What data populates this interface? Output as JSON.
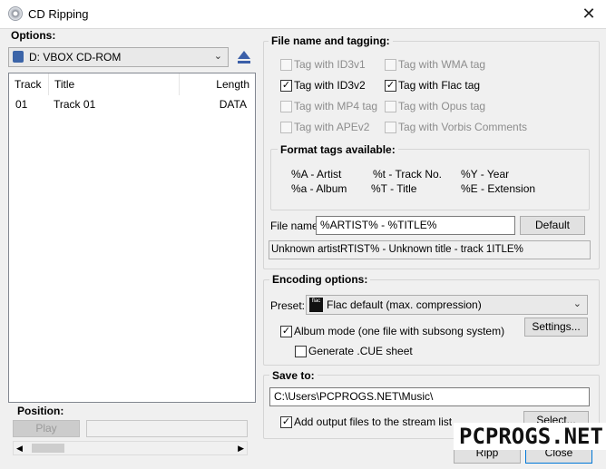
{
  "window": {
    "title": "CD Ripping",
    "close_glyph": "✕"
  },
  "options": {
    "label": "Options:",
    "drive": "D: VBOX CD-ROM",
    "eject_icon": "eject-icon",
    "columns": [
      "Track",
      "Title",
      "Length"
    ],
    "tracks": [
      {
        "track": "01",
        "title": "Track 01",
        "length": "DATA"
      }
    ]
  },
  "position": {
    "label": "Position:",
    "play": "Play"
  },
  "tagging": {
    "label": "File name and tagging:",
    "tags": [
      {
        "label": "Tag with ID3v1",
        "checked": false,
        "enabled": false
      },
      {
        "label": "Tag with WMA tag",
        "checked": false,
        "enabled": false
      },
      {
        "label": "Tag with ID3v2",
        "checked": true,
        "enabled": true
      },
      {
        "label": "Tag with Flac tag",
        "checked": true,
        "enabled": true
      },
      {
        "label": "Tag with MP4 tag",
        "checked": false,
        "enabled": false
      },
      {
        "label": "Tag with Opus tag",
        "checked": false,
        "enabled": false
      },
      {
        "label": "Tag with APEv2",
        "checked": false,
        "enabled": false
      },
      {
        "label": "Tag with Vorbis Comments",
        "checked": false,
        "enabled": false
      }
    ],
    "format_label": "Format tags available:",
    "format_tags": [
      "%A - Artist",
      "%t - Track No.",
      "%Y - Year",
      "%a - Album",
      "%T - Title",
      "%E - Extension"
    ],
    "filename_label": "File name:",
    "filename_value": "%ARTIST% - %TITLE%",
    "default_btn": "Default",
    "preview": "Unknown artistRTIST% - Unknown title - track 1ITLE%"
  },
  "encoding": {
    "label": "Encoding options:",
    "preset_label": "Preset:",
    "preset_icon_text": "flac",
    "preset_value": "Flac default (max. compression)",
    "album_mode": "Album mode (one file with subsong system)",
    "album_mode_checked": true,
    "cue": "Generate .CUE sheet",
    "cue_checked": false,
    "settings_btn": "Settings..."
  },
  "save": {
    "label": "Save to:",
    "path": "C:\\Users\\PCPROGS.NET\\Music\\",
    "add_output": "Add output files to the stream list",
    "add_output_checked": true,
    "select_btn": "Select..."
  },
  "footer": {
    "ripp": "Ripp",
    "close": "Close"
  },
  "watermark": "PCPROGS.NET",
  "colors": {
    "group_border": "#d5d5d5",
    "button_bg": "#e1e1e1"
  }
}
